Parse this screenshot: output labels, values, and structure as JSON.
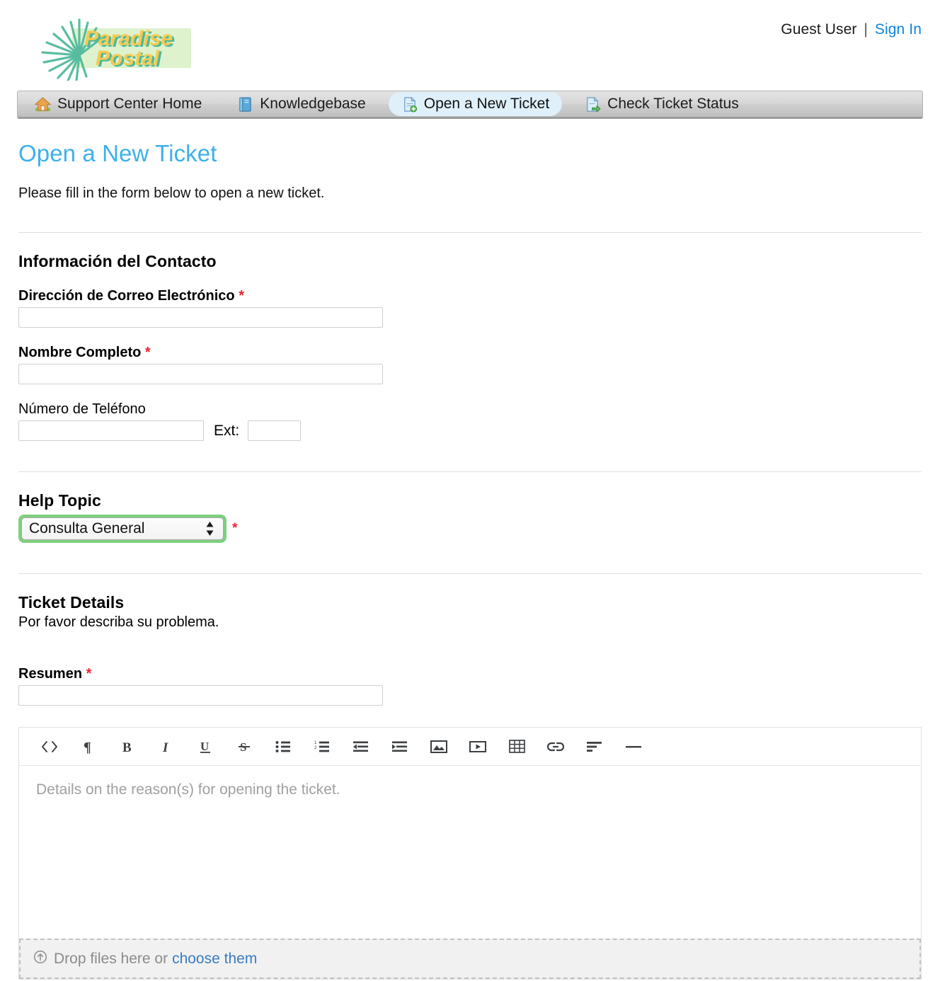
{
  "header": {
    "logo": {
      "line1": "Paradise",
      "line2": "Postal",
      "icon": "palm-fan-icon"
    },
    "user": {
      "name": "Guest User",
      "separator": "|",
      "signin_label": "Sign In"
    }
  },
  "nav": {
    "items": [
      {
        "label": "Support Center Home",
        "icon": "home-icon",
        "active": false
      },
      {
        "label": "Knowledgebase",
        "icon": "book-icon",
        "active": false
      },
      {
        "label": "Open a New Ticket",
        "icon": "new-ticket-icon",
        "active": true
      },
      {
        "label": "Check Ticket Status",
        "icon": "check-status-icon",
        "active": false
      }
    ]
  },
  "page": {
    "title": "Open a New Ticket",
    "intro": "Please fill in the form below to open a new ticket."
  },
  "contact": {
    "heading": "Información del Contacto",
    "email": {
      "label": "Dirección de Correo Electrónico",
      "required": "*",
      "value": "",
      "placeholder": ""
    },
    "fullname": {
      "label": "Nombre Completo",
      "required": "*",
      "value": "",
      "placeholder": ""
    },
    "phone": {
      "label": "Número de Teléfono",
      "value": "",
      "placeholder": ""
    },
    "ext": {
      "label": "Ext:",
      "value": "",
      "placeholder": ""
    }
  },
  "help_topic": {
    "label": "Help Topic",
    "selected": "Consulta General",
    "required": "*"
  },
  "ticket_details": {
    "heading": "Ticket Details",
    "note": "Por favor describa su problema.",
    "summary": {
      "label": "Resumen",
      "required": "*",
      "value": "",
      "placeholder": ""
    },
    "editor": {
      "placeholder": "Details on the reason(s) for opening the ticket.",
      "toolbar": [
        {
          "name": "source-code-icon",
          "title": "<>"
        },
        {
          "name": "paragraph-icon",
          "title": "¶"
        },
        {
          "name": "bold-icon",
          "title": "B"
        },
        {
          "name": "italic-icon",
          "title": "I"
        },
        {
          "name": "underline-icon",
          "title": "U"
        },
        {
          "name": "strikethrough-icon",
          "title": "S"
        },
        {
          "name": "bullet-list-icon",
          "title": ""
        },
        {
          "name": "numbered-list-icon",
          "title": ""
        },
        {
          "name": "outdent-icon",
          "title": ""
        },
        {
          "name": "indent-icon",
          "title": ""
        },
        {
          "name": "image-icon",
          "title": ""
        },
        {
          "name": "video-icon",
          "title": ""
        },
        {
          "name": "table-icon",
          "title": ""
        },
        {
          "name": "link-icon",
          "title": ""
        },
        {
          "name": "align-icon",
          "title": ""
        },
        {
          "name": "horizontal-rule-icon",
          "title": ""
        }
      ]
    },
    "dropzone": {
      "icon": "upload-circle-icon",
      "text": "Drop files here or",
      "link": "choose them"
    }
  },
  "colors": {
    "title_blue": "#3db0ec",
    "link_blue": "#0a84e0",
    "required_red": "#f1202e",
    "focus_green": "#7ed07e",
    "logo_yellow": "#f6c951",
    "logo_teal": "#4cb89b",
    "logo_bg": "#ddf2cd",
    "active_tab_bg": "#dff0fb",
    "dropzone_link": "#3a7bbf"
  }
}
